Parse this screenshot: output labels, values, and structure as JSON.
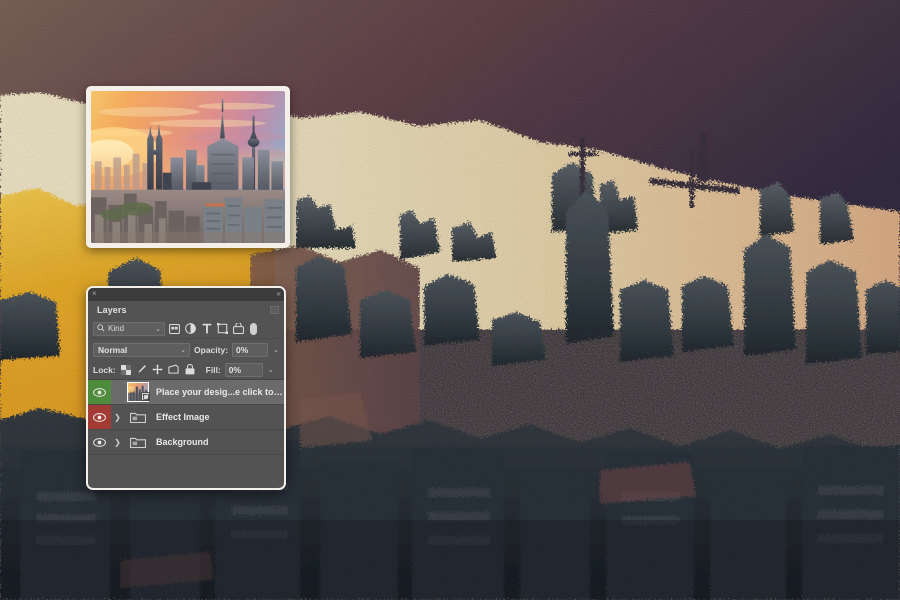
{
  "artwork": {
    "name": "city-skyline-stipple-artwork",
    "description": "Textured stippled painterly rendering of a city skyline at dusk",
    "colors": {
      "sky_top_left": "#6a5a52",
      "sky_top_right": "#3b3246",
      "sky_plum": "#6b4950",
      "band_cream": "#e6d8b8",
      "band_tan": "#ddb790",
      "gold_left": "#e0a72a",
      "gold_bright": "#edb93a",
      "building_slate": "#4d5358",
      "building_dark": "#2f3338",
      "building_teal": "#354047",
      "foreground_dark": "#24282c"
    }
  },
  "photo_card": {
    "name": "image-preview-card",
    "alt": "Kuala Lumpur city skyline at sunset with Petronas Towers and KL Tower",
    "colors": {
      "frame": "#f4efe9",
      "sky_orange": "#f2a45c",
      "sky_gold": "#f7c96a",
      "sky_pink": "#e58a86",
      "sky_mauve": "#b98aa0",
      "sky_blue": "#9aa8c4",
      "haze": "#e8bb8a",
      "tower_dark": "#4a4f5c",
      "tower_mid": "#6d727e",
      "tower_light": "#a8aab3"
    }
  },
  "panel": {
    "name": "layers-panel",
    "close_icon": "×",
    "collapse_icon": "«",
    "tab_label": "Layers",
    "menu_icon": "panel-menu-icon",
    "filter": {
      "kind_label": "Kind",
      "search_icon": "search-icon",
      "caret": "⌄",
      "icons": [
        {
          "name": "filter-pixel-layers-icon",
          "glyph": "image"
        },
        {
          "name": "filter-adjustment-layers-icon",
          "glyph": "half-circle"
        },
        {
          "name": "filter-type-layers-icon",
          "glyph": "T"
        },
        {
          "name": "filter-shape-layers-icon",
          "glyph": "square"
        },
        {
          "name": "filter-smart-object-layers-icon",
          "glyph": "smart-object"
        }
      ],
      "toggle_name": "filter-enable-toggle"
    },
    "blend": {
      "mode": "Normal",
      "caret": "⌄",
      "opacity_label": "Opacity:",
      "opacity_value": "0%"
    },
    "lock": {
      "label": "Lock:",
      "icons": [
        {
          "name": "lock-transparent-pixels-icon",
          "glyph": "checkerboard"
        },
        {
          "name": "lock-image-pixels-icon",
          "glyph": "brush"
        },
        {
          "name": "lock-position-icon",
          "glyph": "move-arrows"
        },
        {
          "name": "lock-artboard-nesting-icon",
          "glyph": "artboard"
        },
        {
          "name": "lock-all-icon",
          "glyph": "padlock"
        }
      ],
      "fill_label": "Fill:",
      "fill_value": "0%"
    },
    "layers": [
      {
        "name": "Place your desig...e click to edit)",
        "type": "smart-object",
        "visible": true,
        "selected": true,
        "eye_highlight": "green",
        "has_twisty": false,
        "thumbnail": "city-photo-thumbnail"
      },
      {
        "name": "Effect Image",
        "type": "group",
        "visible": true,
        "selected": false,
        "eye_highlight": "red",
        "has_twisty": true,
        "thumbnail": "folder-icon"
      },
      {
        "name": "Background",
        "type": "group",
        "visible": true,
        "selected": false,
        "eye_highlight": "none",
        "has_twisty": true,
        "thumbnail": "folder-icon"
      }
    ]
  }
}
